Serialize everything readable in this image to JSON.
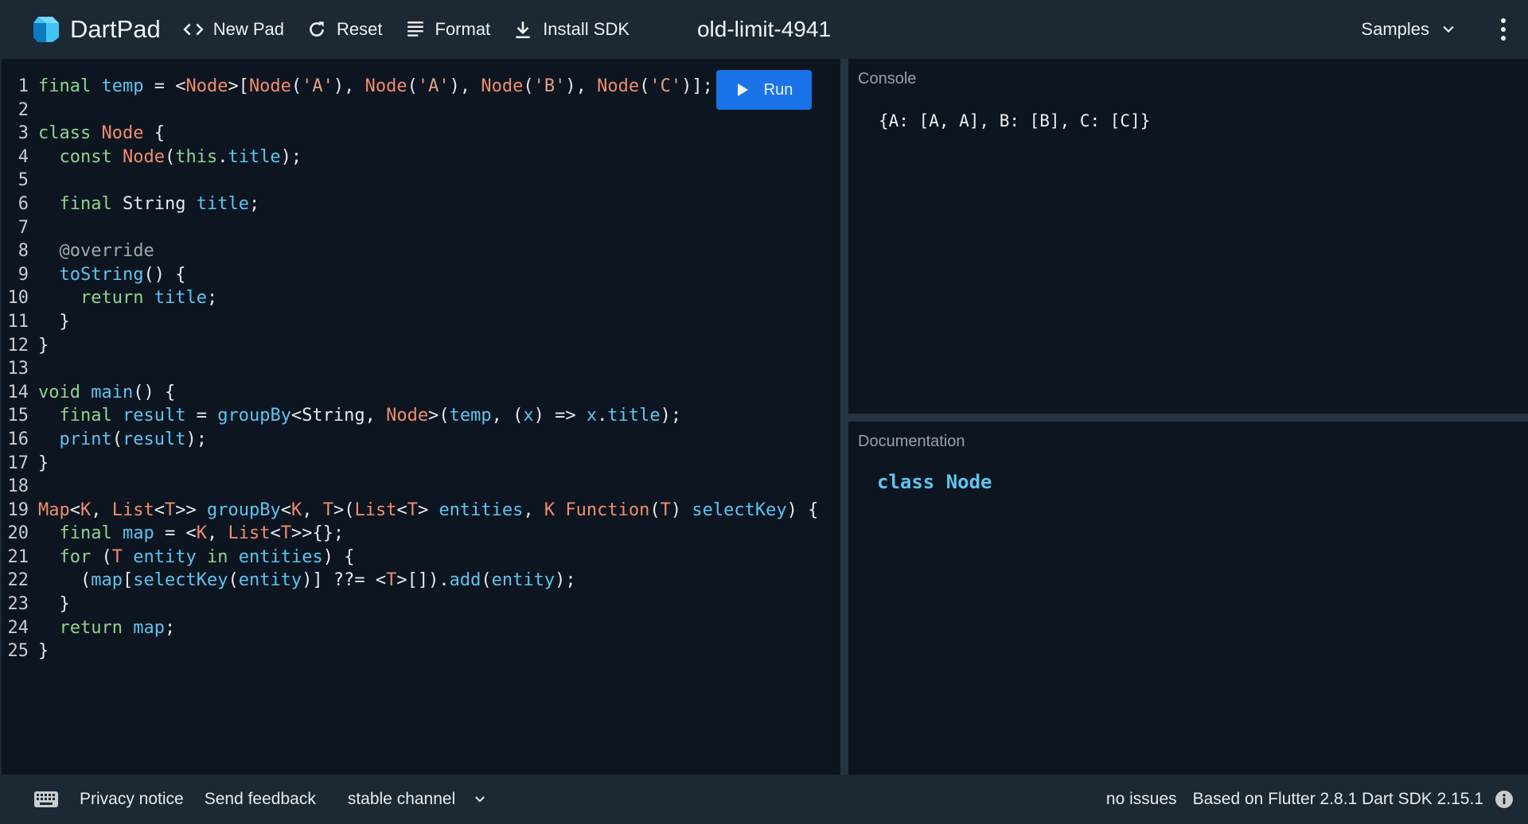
{
  "header": {
    "app_name": "DartPad",
    "new_pad": "New Pad",
    "reset": "Reset",
    "format": "Format",
    "install_sdk": "Install SDK",
    "pad_title": "old-limit-4941",
    "samples": "Samples"
  },
  "editor": {
    "run_label": "Run",
    "line_numbers": [
      "1",
      "2",
      "3",
      "4",
      "5",
      "6",
      "7",
      "8",
      "9",
      "10",
      "11",
      "12",
      "13",
      "14",
      "15",
      "16",
      "17",
      "18",
      "19",
      "20",
      "21",
      "22",
      "23",
      "24",
      "25"
    ],
    "lines": [
      "final temp = <Node>[Node('A'), Node('A'), Node('B'), Node('C')];",
      "",
      "class Node {",
      "  const Node(this.title);",
      "",
      "  final String title;",
      "",
      "  @override",
      "  toString() {",
      "    return title;",
      "  }",
      "}",
      "",
      "void main() {",
      "  final result = groupBy<String, Node>(temp, (x) => x.title);",
      "  print(result);",
      "}",
      "",
      "Map<K, List<T>> groupBy<K, T>(List<T> entities, K Function(T) selectKey) {",
      "  final map = <K, List<T>>{};",
      "  for (T entity in entities) {",
      "    (map[selectKey(entity)] ??= <T>[]).add(entity);",
      "  }",
      "  return map;",
      "}"
    ]
  },
  "console": {
    "label": "Console",
    "output": "{A: [A, A], B: [B], C: [C]}"
  },
  "documentation": {
    "label": "Documentation",
    "content": "class Node"
  },
  "footer": {
    "privacy": "Privacy notice",
    "feedback": "Send feedback",
    "channel": "stable channel",
    "issues": "no issues",
    "sdk_info": "Based on Flutter 2.8.1 Dart SDK 2.15.1"
  },
  "colors": {
    "chrome_bg": "#1c2834",
    "editor_bg": "#0d1520",
    "run_button": "#1a73e8",
    "keyword": "#8fd48f",
    "type": "#f08d6c",
    "identifier": "#5ec4f0"
  },
  "icons": [
    "dart-logo-icon",
    "code-icon",
    "refresh-icon",
    "format-icon",
    "download-icon",
    "chevron-down-icon",
    "more-vert-icon",
    "play-icon",
    "keyboard-icon",
    "info-icon"
  ]
}
